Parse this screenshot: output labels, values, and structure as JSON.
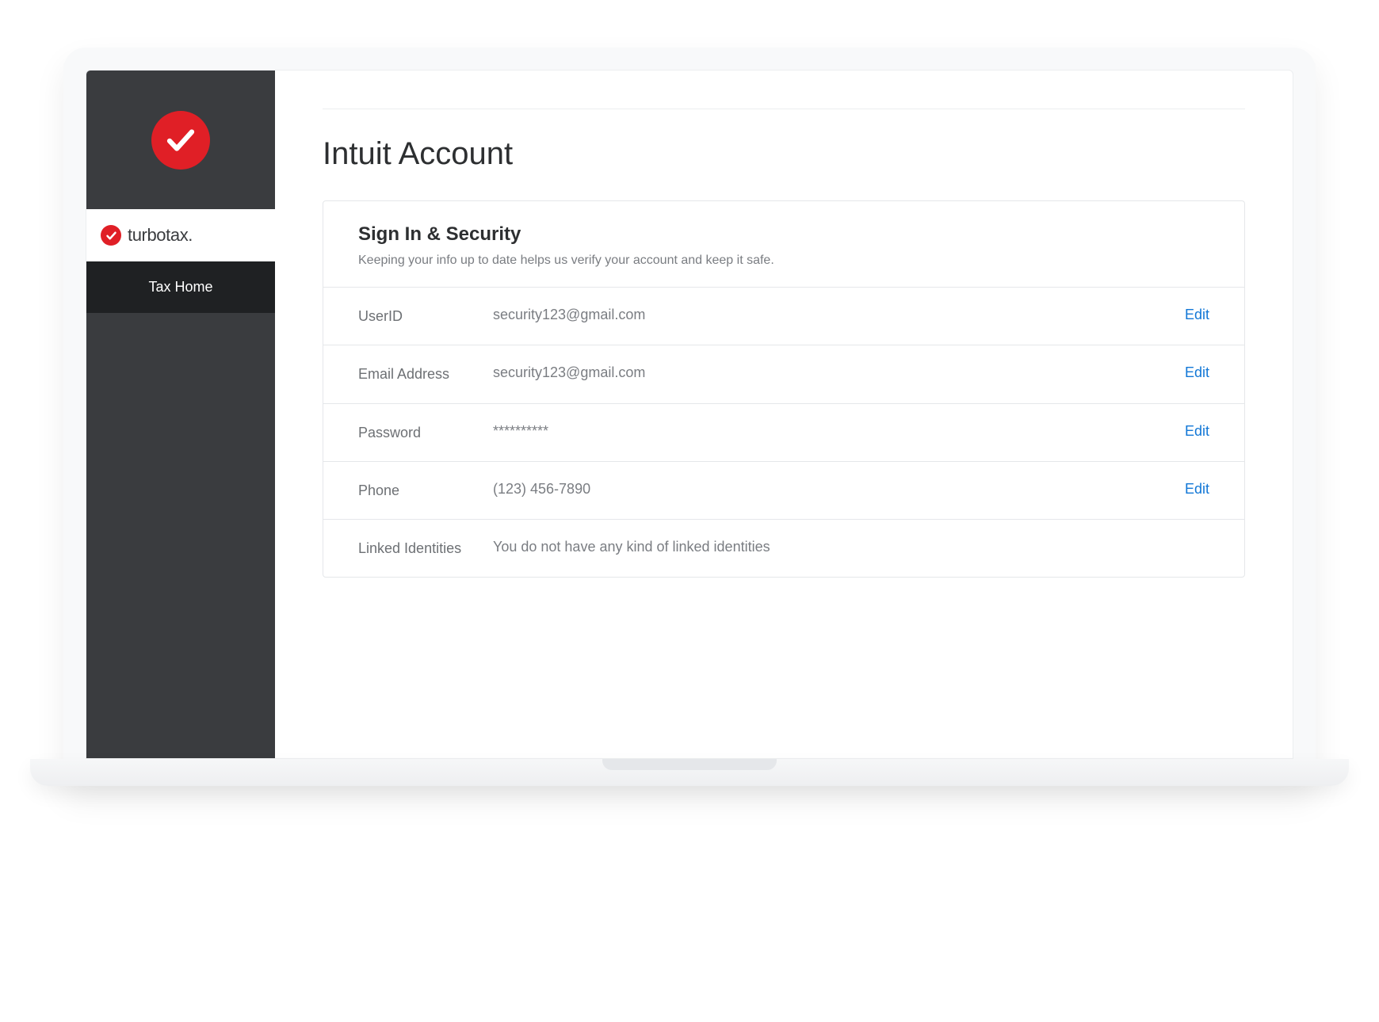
{
  "brand": {
    "name": "turbotax."
  },
  "sidebar": {
    "nav": [
      {
        "label": "Tax Home"
      }
    ]
  },
  "page": {
    "title": "Intuit Account"
  },
  "security_card": {
    "title": "Sign In & Security",
    "subtitle": "Keeping your info up to date helps us verify your account and keep it safe.",
    "edit_label": "Edit",
    "rows": [
      {
        "label": "UserID",
        "value": "security123@gmail.com",
        "editable": true
      },
      {
        "label": "Email Address",
        "value": "security123@gmail.com",
        "editable": true
      },
      {
        "label": "Password",
        "value": "**********",
        "editable": true
      },
      {
        "label": "Phone",
        "value": "(123) 456-7890",
        "editable": true
      },
      {
        "label": "Linked Identities",
        "value": "You do not have any kind of linked identities",
        "editable": false
      }
    ]
  }
}
